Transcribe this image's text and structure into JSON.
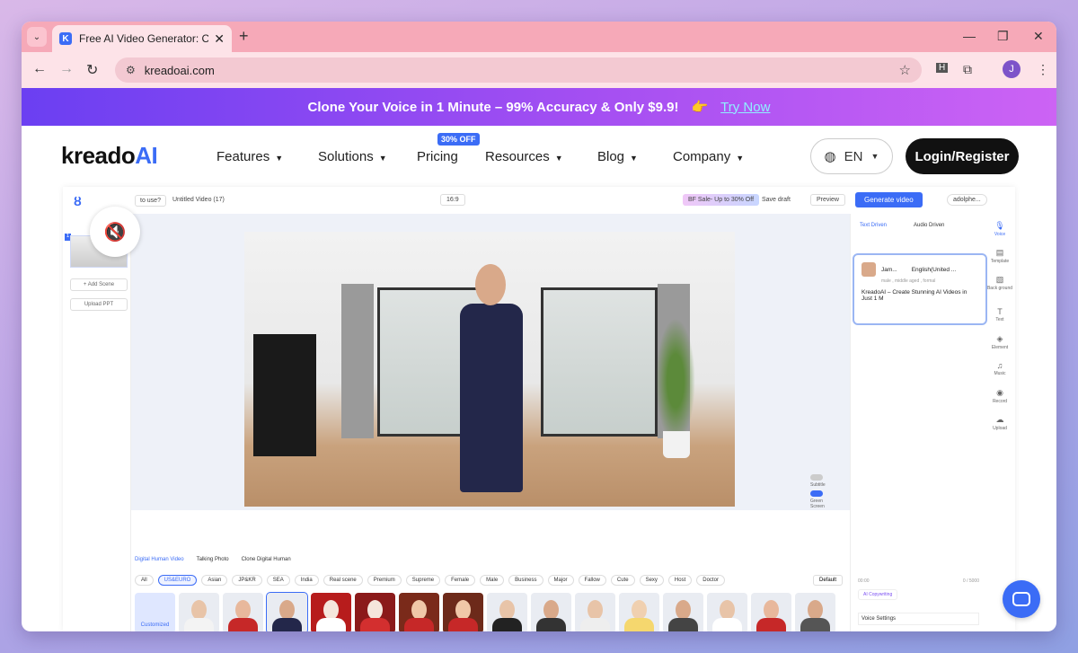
{
  "browser": {
    "tab_title": "Free AI Video Generator: Create",
    "url": "kreadoai.com",
    "profile_initial": "J",
    "ext_initial": "H"
  },
  "promo": {
    "text": "Clone Your Voice in 1 Minute – 99% Accuracy & Only $9.9!",
    "emoji": "👉",
    "cta": "Try Now"
  },
  "header": {
    "logo_main": "kreado",
    "logo_ai": "AI",
    "nav": [
      {
        "label": "Features"
      },
      {
        "label": "Solutions"
      },
      {
        "label": "Pricing"
      },
      {
        "label": "Resources"
      },
      {
        "label": "Blog"
      },
      {
        "label": "Company"
      }
    ],
    "pricing_badge": "30% OFF",
    "lang": "EN",
    "login": "Login/Register"
  },
  "editor": {
    "howto": "to use?",
    "video_name": "Untitled Video (17)",
    "ratio": "16:9",
    "sale": "BF Sale- Up to 30% Off",
    "save_draft": "Save draft",
    "preview": "Preview",
    "generate": "Generate video",
    "user": "adolphe...",
    "add_scene": "+ Add Scene",
    "upload_ppt": "Upload PPT",
    "scene_number": "1",
    "subtitle": "Subtitle",
    "green_screen": "Green Screen",
    "tabs": [
      "Digital Human Video",
      "Talking Photo",
      "Clone Digital Human"
    ],
    "filters": [
      "All",
      "US&EURO",
      "Asian",
      "JP&KR",
      "SEA",
      "India",
      "Real scene",
      "Premium",
      "Supreme",
      "Female",
      "Male",
      "Business",
      "Major",
      "Fallow",
      "Cute",
      "Sexy",
      "Host",
      "Doctor"
    ],
    "default_sort": "Default",
    "customized": "Customized",
    "right_tabs": [
      "Text Driven",
      "Audio Driven"
    ],
    "voice_name": "Jam...",
    "voice_lang": "English(United ...",
    "voice_meta": "male , middle aged , formal",
    "voice_text": "KreadoAI – Create Stunning AI Videos in Just 1 M",
    "time": "00:00",
    "count": "0 / 5000",
    "ai_copy": "AI Copywriting",
    "voice_settings": "Voice Settings",
    "rail": [
      "Voice",
      "Template",
      "Back ground",
      "Text",
      "Element",
      "Music",
      "Record",
      "Upload"
    ]
  },
  "colors": {
    "accent": "#3b6cf6",
    "promo_start": "#6b3ff2",
    "promo_end": "#cc63f4",
    "tabstrip": "#f6a9b8"
  }
}
